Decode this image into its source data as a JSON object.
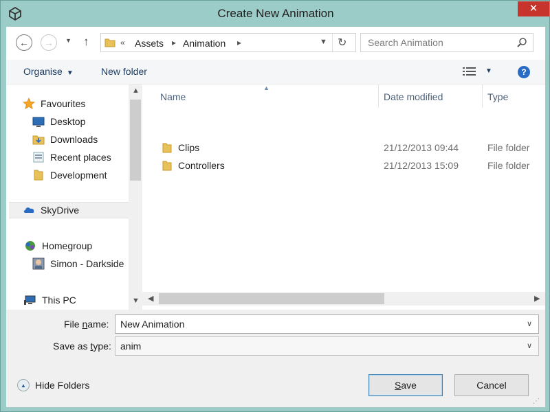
{
  "window": {
    "title": "Create New Animation",
    "close_glyph": "✕"
  },
  "address": {
    "overflow": "«",
    "crumbs": [
      "Assets",
      "Animation"
    ],
    "search_placeholder": "Search Animation"
  },
  "toolbar": {
    "organise": "Organise",
    "new_folder": "New folder",
    "help_glyph": "?"
  },
  "nav": {
    "favourites": "Favourites",
    "desktop": "Desktop",
    "downloads": "Downloads",
    "recent_places": "Recent places",
    "development": "Development",
    "skydrive": "SkyDrive",
    "homegroup": "Homegroup",
    "simon": "Simon - Darkside",
    "this_pc": "This PC"
  },
  "columns": {
    "name": "Name",
    "date": "Date modified",
    "type": "Type"
  },
  "files": [
    {
      "name": "Clips",
      "date": "21/12/2013 09:44",
      "type": "File folder"
    },
    {
      "name": "Controllers",
      "date": "21/12/2013 15:09",
      "type": "File folder"
    }
  ],
  "form": {
    "file_name_prefix": "File ",
    "file_name_underlined": "n",
    "file_name_suffix": "ame:",
    "file_name_value": "New Animation",
    "save_type_prefix": "Save as ",
    "save_type_underlined": "t",
    "save_type_suffix": "ype:",
    "save_type_value": "anim"
  },
  "footer": {
    "hide_folders": "Hide Folders",
    "save_underlined": "S",
    "save_rest": "ave",
    "cancel": "Cancel"
  },
  "colors": {
    "frame": "#9cccc8",
    "close": "#c7342b",
    "link_text": "#1e3c64",
    "folder": "#e9c15a"
  }
}
